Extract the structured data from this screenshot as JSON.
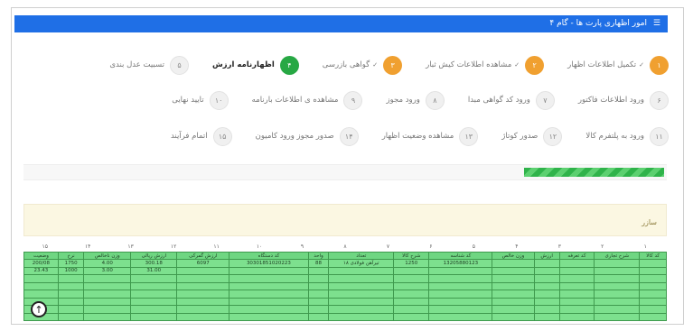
{
  "header": {
    "title": "امور اظهاری پارت ها - گام ۴",
    "icon": "list-icon"
  },
  "steps_row1": [
    {
      "num": "۱",
      "label": "تکمیل اطلاعات اظهار",
      "state": "done",
      "check": "✓"
    },
    {
      "num": "۲",
      "label": "مشاهده اطلاعات کیش ثبار",
      "state": "done",
      "check": "✓"
    },
    {
      "num": "۳",
      "label": "گواهی بازرسی",
      "state": "done",
      "check": "✓"
    },
    {
      "num": "۴",
      "label": "اظهارنامه ارزش",
      "state": "active",
      "check": ""
    },
    {
      "num": "۵",
      "label": "تسبیت عدل بندی",
      "state": "pending",
      "check": ""
    }
  ],
  "steps_row2": [
    {
      "num": "۶",
      "label": "ورود اطلاعات فاکتور"
    },
    {
      "num": "۷",
      "label": "ورود کد گواهی مبدا"
    },
    {
      "num": "۸",
      "label": "ورود مجوز"
    },
    {
      "num": "۹",
      "label": "مشاهده ی اطلاعات بارنامه"
    },
    {
      "num": "۱۰",
      "label": "تایید نهایی"
    }
  ],
  "steps_row3": [
    {
      "num": "۱۱",
      "label": "ورود به پلتفرم کالا"
    },
    {
      "num": "۱۲",
      "label": "صدور کوتاژ"
    },
    {
      "num": "۱۳",
      "label": "مشاهده وضعیت اظهار"
    },
    {
      "num": "۱۴",
      "label": "صدور مجوز ورود کامیون"
    },
    {
      "num": "۱۵",
      "label": "اتمام فرآیند"
    }
  ],
  "notice": {
    "text": "سازر"
  },
  "table": {
    "column_numbers": [
      "۱",
      "۲",
      "۳",
      "۴",
      "۵",
      "۶",
      "۷",
      "۸",
      "۹",
      "۱۰",
      "۱۱",
      "۱۲",
      "۱۳",
      "۱۴",
      "۱۵"
    ],
    "headers": [
      "کد کالا",
      "شرح تجاری",
      "کد تعرفه",
      "ارزش",
      "وزن خالص",
      "کد شناسه",
      "شرح کالا",
      "تعداد",
      "واحد",
      "کد دستگاه",
      "ارزش گمرکی",
      "ارزش ریالی",
      "وزن ناخالص",
      "نرخ",
      "وضعیت"
    ],
    "rows": [
      [
        "",
        "",
        "",
        "",
        "",
        "13205880123",
        "1250",
        "تیرآهن فولادی ۱۸",
        "88",
        "30301851020223",
        "6097",
        "300.18",
        "4.00",
        "1750",
        "200/08"
      ],
      [
        "",
        "",
        "",
        "",
        "",
        "",
        "",
        "",
        "",
        "",
        "",
        "31.00",
        "3.00",
        "1000",
        "23.43"
      ],
      [
        "",
        "",
        "",
        "",
        "",
        "",
        "",
        "",
        "",
        "",
        "",
        "",
        "",
        "",
        ""
      ],
      [
        "",
        "",
        "",
        "",
        "",
        "",
        "",
        "",
        "",
        "",
        "",
        "",
        "",
        "",
        ""
      ],
      [
        "",
        "",
        "",
        "",
        "",
        "",
        "",
        "",
        "",
        "",
        "",
        "",
        "",
        "",
        ""
      ],
      [
        "",
        "",
        "",
        "",
        "",
        "",
        "",
        "",
        "",
        "",
        "",
        "",
        "",
        "",
        ""
      ],
      [
        "",
        "",
        "",
        "",
        "",
        "",
        "",
        "",
        "",
        "",
        "",
        "",
        "",
        "",
        ""
      ],
      [
        "",
        "",
        "",
        "",
        "",
        "",
        "",
        "",
        "",
        "",
        "",
        "",
        "",
        "",
        ""
      ]
    ]
  },
  "scroll_top": {
    "icon": "arrow-up-circle-icon",
    "glyph": "↑"
  }
}
